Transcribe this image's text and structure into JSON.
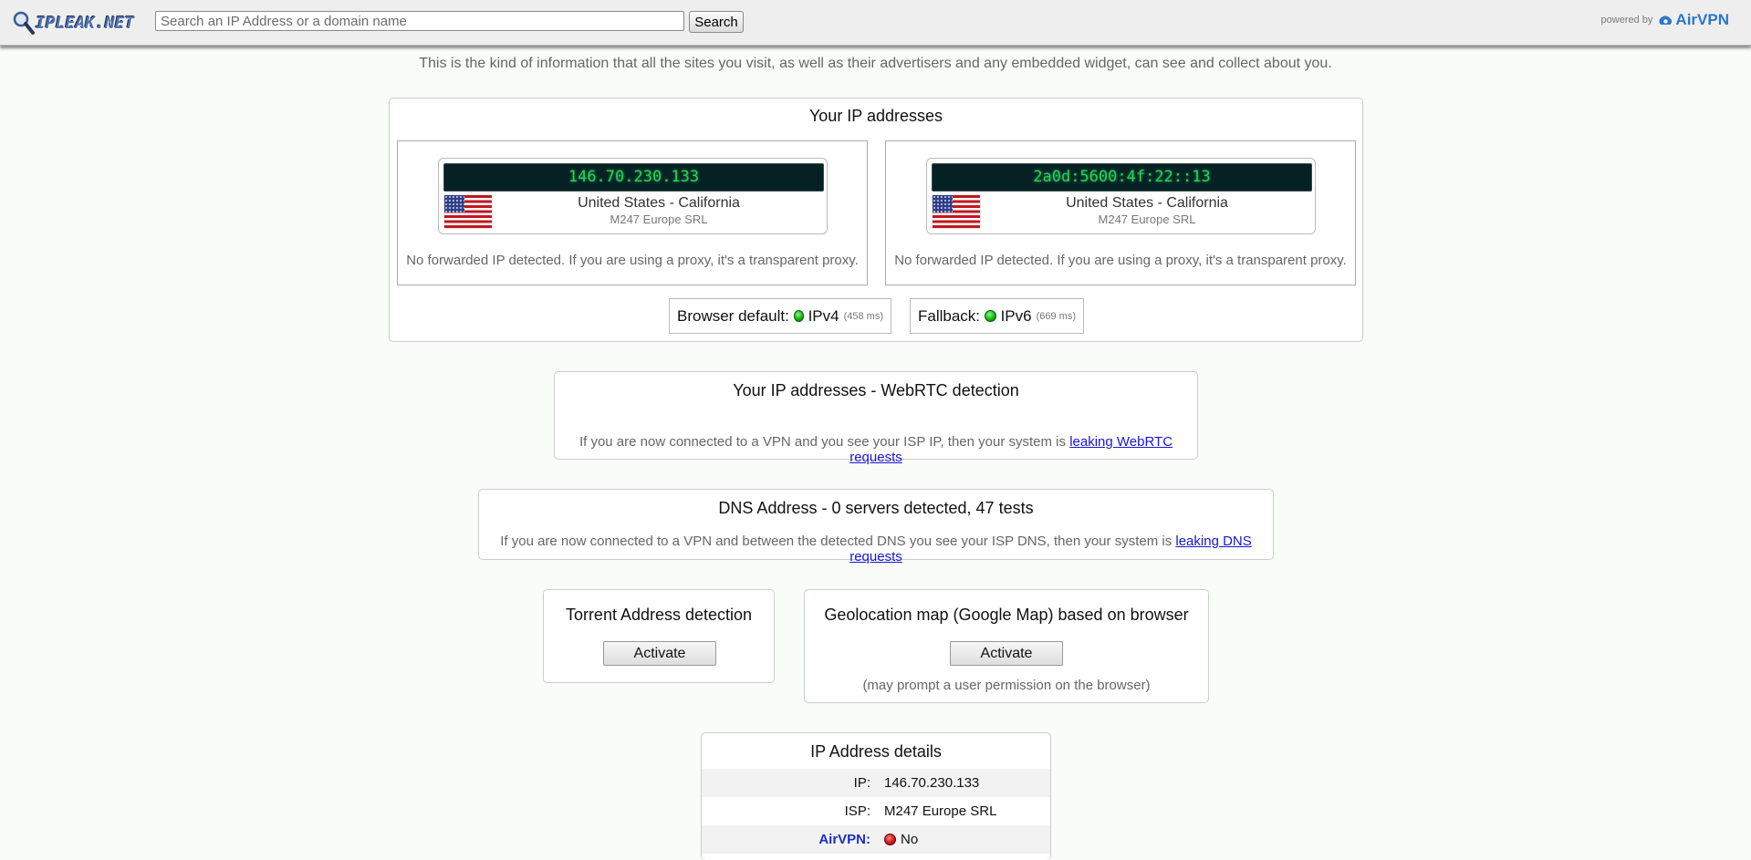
{
  "header": {
    "logo_text": "IPLEAK.NET",
    "search_placeholder": "Search an IP Address or a domain name",
    "search_button": "Search",
    "powered_by": "powered by",
    "brand": "AirVPN"
  },
  "tagline": "This is the kind of information that all the sites you visit, as well as their advertisers and any embedded widget, can see and collect about you.",
  "ip_addresses": {
    "title": "Your IP addresses",
    "cards": [
      {
        "ip": "146.70.230.133",
        "location": "United States - California",
        "isp": "M247 Europe SRL",
        "forwarded": "No forwarded IP detected. If you are using a proxy, it's a transparent proxy.",
        "flag": "us-flag"
      },
      {
        "ip": "2a0d:5600:4f:22::13",
        "location": "United States - California",
        "isp": "M247 Europe SRL",
        "forwarded": "No forwarded IP detected. If you are using a proxy, it's a transparent proxy.",
        "flag": "us-flag"
      }
    ],
    "browser_default": {
      "label": "Browser default:",
      "proto": "IPv4",
      "ms": "(458 ms)",
      "status_color": "#15b515"
    },
    "fallback": {
      "label": "Fallback:",
      "proto": "IPv6",
      "ms": "(669 ms)",
      "status_color": "#15b515"
    }
  },
  "webrtc": {
    "title": "Your IP addresses - WebRTC detection",
    "desc": "If you are now connected to a VPN and you see your ISP IP, then your system is",
    "link": "leaking WebRTC requests"
  },
  "dns": {
    "title": "DNS Address - 0 servers detected, 47 tests",
    "desc": "If you are now connected to a VPN and between the detected DNS you see your ISP DNS, then your system is",
    "link": "leaking DNS requests"
  },
  "torrent": {
    "title": "Torrent Address detection",
    "button": "Activate"
  },
  "geolocation": {
    "title": "Geolocation map (Google Map) based on browser",
    "button": "Activate",
    "note": "(may prompt a user permission on the browser)"
  },
  "details": {
    "title": "IP Address details",
    "rows": [
      {
        "key": "IP:",
        "value": "146.70.230.133"
      },
      {
        "key": "ISP:",
        "value": "M247 Europe SRL"
      },
      {
        "key": "AirVPN:",
        "value": "No",
        "status_color": "#d11515"
      }
    ]
  }
}
